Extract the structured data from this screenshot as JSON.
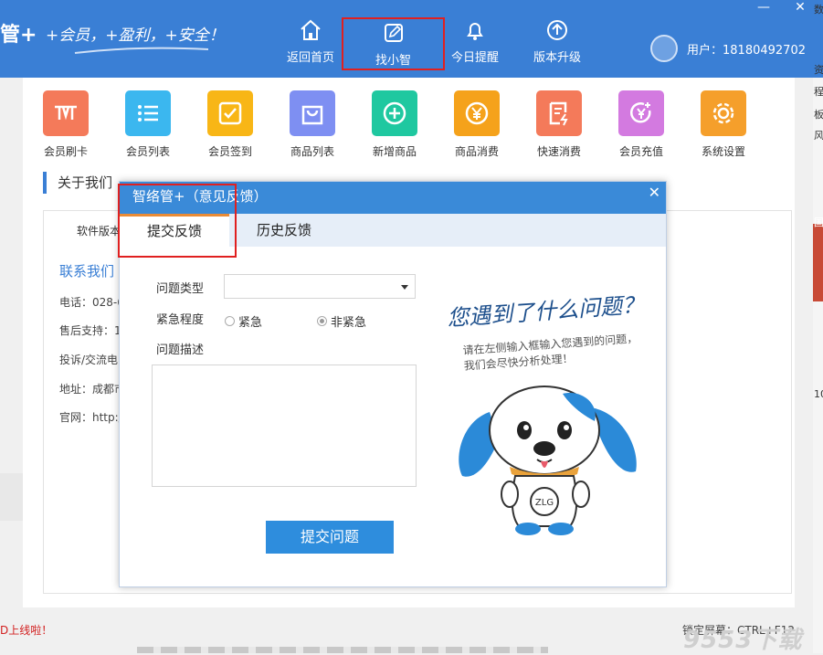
{
  "header": {
    "brand": "管+",
    "slogan": "+会员，+盈利，+安全！",
    "nav": [
      {
        "label": "返回首页",
        "icon": "home-icon"
      },
      {
        "label": "找小智",
        "icon": "edit-icon"
      },
      {
        "label": "今日提醒",
        "icon": "bell-icon"
      },
      {
        "label": "版本升级",
        "icon": "upload-icon"
      }
    ],
    "user": "用户：18180492702",
    "win_min": "—",
    "win_close": "✕"
  },
  "functions": [
    {
      "label": "会员刷卡",
      "color": "#f47a5a"
    },
    {
      "label": "会员列表",
      "color": "#3bb7ef"
    },
    {
      "label": "会员签到",
      "color": "#f8b616"
    },
    {
      "label": "商品列表",
      "color": "#7e8ff2"
    },
    {
      "label": "新增商品",
      "color": "#1fc8a0"
    },
    {
      "label": "商品消费",
      "color": "#f5a21b"
    },
    {
      "label": "快速消费",
      "color": "#f47a5a"
    },
    {
      "label": "会员充值",
      "color": "#d37ae0"
    },
    {
      "label": "系统设置",
      "color": "#f59f2b"
    }
  ],
  "about": {
    "section_title": "关于我们",
    "tab": "软件版本",
    "contact_title": "联系我们",
    "lines": [
      "电话：028-6",
      "售后支持：1",
      "投诉/交流电",
      "地址：成都市",
      "官网：http:/"
    ]
  },
  "dialog": {
    "title": "智络管+（意见反馈）",
    "close": "✕",
    "tabs": [
      "提交反馈",
      "历史反馈"
    ],
    "labels": {
      "type": "问题类型",
      "urgency": "紧急程度",
      "desc": "问题描述"
    },
    "select_value": "",
    "radios": [
      {
        "label": "紧急",
        "checked": false
      },
      {
        "label": "非紧急",
        "checked": true
      }
    ],
    "submit": "提交问题",
    "prompt_big": "您遇到了什么问题？",
    "prompt_small_1": "请在左侧输入框输入您遇到的问题，",
    "prompt_small_2": "我们会尽快分析处理！",
    "mascot_badge": "ZLG"
  },
  "status": {
    "left": "D上线啦！",
    "right": "锁定屏幕：CTRL+F12",
    "watermark": "9553下载"
  },
  "rightstrip": [
    "数",
    "资",
    "程",
    "板",
    "风",
    "国",
    "10"
  ]
}
